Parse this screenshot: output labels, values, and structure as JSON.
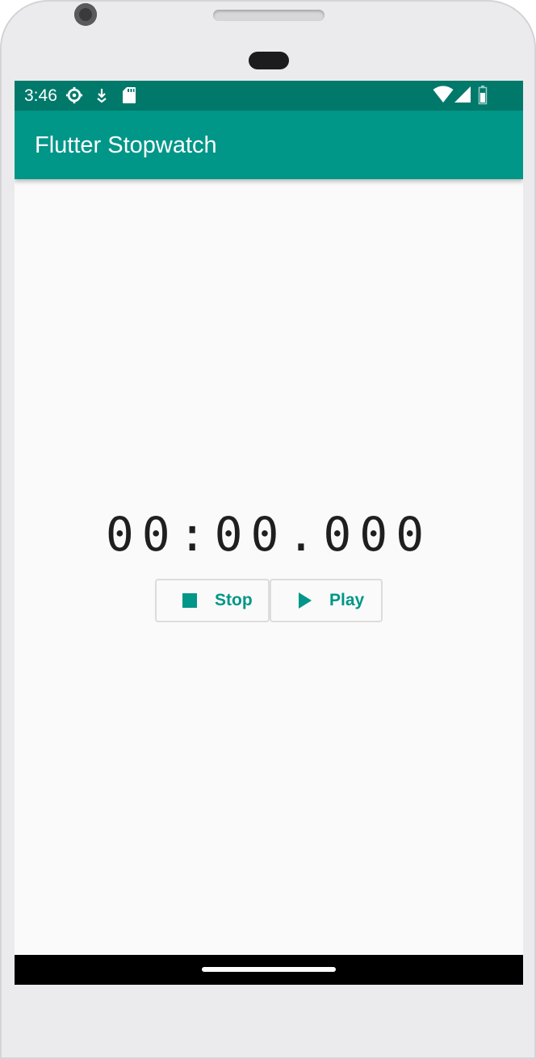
{
  "status_bar": {
    "time": "3:46",
    "left_icons": [
      "settings-icon",
      "download-icon",
      "sd-card-icon"
    ],
    "right_icons": [
      "wifi-icon",
      "cell-signal-icon",
      "battery-icon"
    ],
    "background": "#00796b"
  },
  "app_bar": {
    "title": "Flutter Stopwatch",
    "background": "#009688"
  },
  "stopwatch": {
    "display": "00:00.000"
  },
  "buttons": {
    "stop": {
      "label": "Stop",
      "icon": "stop-icon"
    },
    "play": {
      "label": "Play",
      "icon": "play-icon"
    },
    "accent": "#009688"
  },
  "nav_bar": {
    "background": "#000000",
    "handle": "home-gesture-handle"
  }
}
